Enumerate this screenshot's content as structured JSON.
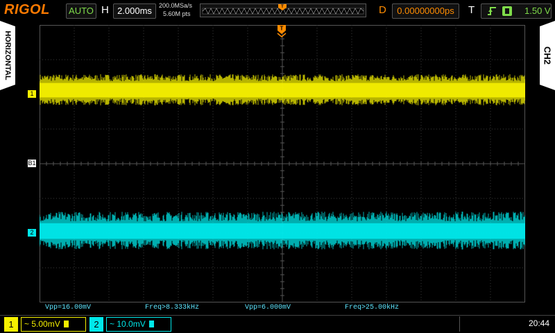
{
  "header": {
    "brand": "RIGOL",
    "run_state": "AUTO",
    "horizontal_label": "H",
    "timebase": "2.000ms",
    "sample_rate": "200.0MSa/s",
    "memory_depth": "5.60M pts",
    "delay_label": "D",
    "delay_value": "0.00000000ps",
    "trigger_label": "T",
    "trigger_level": "1.50 V",
    "trigger_marker": "T"
  },
  "side_tabs": {
    "left": "HORIZONTAL",
    "right": "CH2"
  },
  "markers": {
    "ch1": "1",
    "ch2": "2",
    "bus": "B1",
    "trigger_top": "T"
  },
  "measurements": {
    "ch1_vpp": "Vpp=16.00mV",
    "ch1_freq": "Freq>8.333kHz",
    "ch2_vpp": "Vpp=6.000mV",
    "ch2_freq": "Freq>25.00kHz"
  },
  "channels": [
    {
      "number": "1",
      "scale": "5.00mV",
      "color": "#f5f000"
    },
    {
      "number": "2",
      "scale": "10.0mV",
      "color": "#00e8ea"
    }
  ],
  "clock": "20:44",
  "colors": {
    "ch1": "#f5f000",
    "ch2": "#00e8ea",
    "trigger": "#ff8c00",
    "run_state": "#7fdc4a",
    "grid": "#3a3a3a"
  }
}
